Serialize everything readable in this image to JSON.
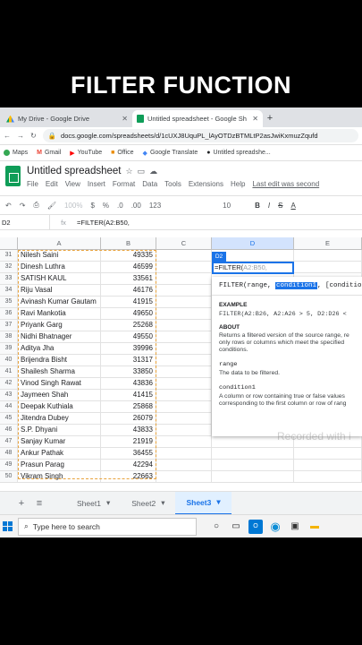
{
  "banner": {
    "title": "FILTER FUNCTION"
  },
  "browser": {
    "tabs": [
      {
        "label": "My Drive - Google Drive",
        "icon": "drive-icon",
        "active": false
      },
      {
        "label": "Untitled spreadsheet - Google Sh",
        "icon": "sheets-icon",
        "active": true
      }
    ],
    "url": "docs.google.com/spreadsheets/d/1cUXJ8UquPL_lAyOTDzBTMLtP2asJwiKxmuzZqufd",
    "bookmarks": [
      "Maps",
      "Gmail",
      "YouTube",
      "Office",
      "Google Translate",
      "Untitled spreadshe..."
    ]
  },
  "sheets": {
    "doc_title": "Untitled spreadsheet",
    "menus": [
      "File",
      "Edit",
      "View",
      "Insert",
      "Format",
      "Data",
      "Tools",
      "Extensions",
      "Help"
    ],
    "last_edit": "Last edit was second",
    "toolbar": {
      "zoom": "100%",
      "currency": "$",
      "percent": "%",
      "dec_less": ".0",
      "dec_more": ".00",
      "format": "123",
      "font_size": "10"
    },
    "cell_ref": "D2",
    "formula": "=FILTER(A2:B50,",
    "columns": [
      "A",
      "B",
      "C",
      "D",
      "E"
    ],
    "rows": [
      {
        "n": "31",
        "name": "Nilesh Saini",
        "val": "49335"
      },
      {
        "n": "32",
        "name": "Dinesh Luthra",
        "val": "46599"
      },
      {
        "n": "33",
        "name": "SATISH KAUL",
        "val": "33561"
      },
      {
        "n": "34",
        "name": "Riju Vasal",
        "val": "46176"
      },
      {
        "n": "35",
        "name": "Avinash Kumar Gautam",
        "val": "41915"
      },
      {
        "n": "36",
        "name": "Ravi Mankotia",
        "val": "49650"
      },
      {
        "n": "37",
        "name": "Priyank Garg",
        "val": "25268"
      },
      {
        "n": "38",
        "name": "Nidhi Bhatnager",
        "val": "49550"
      },
      {
        "n": "39",
        "name": "Aditya Jha",
        "val": "39996"
      },
      {
        "n": "40",
        "name": "Brijendra Bisht",
        "val": "31317"
      },
      {
        "n": "41",
        "name": "Shailesh Sharma",
        "val": "33850"
      },
      {
        "n": "42",
        "name": "Vinod Singh Rawat",
        "val": "43836"
      },
      {
        "n": "43",
        "name": "Jaymeen Shah",
        "val": "41415"
      },
      {
        "n": "44",
        "name": "Deepak Kuthiala",
        "val": "25868"
      },
      {
        "n": "45",
        "name": "Jitendra Dubey",
        "val": "26079"
      },
      {
        "n": "46",
        "name": "S.P. Dhyani",
        "val": "43833"
      },
      {
        "n": "47",
        "name": "Sanjay Kumar",
        "val": "21919"
      },
      {
        "n": "48",
        "name": "Ankur Pathak",
        "val": "36455"
      },
      {
        "n": "49",
        "name": "Prasun Parag",
        "val": "42294"
      },
      {
        "n": "50",
        "name": "Vikram Singh",
        "val": "22663"
      }
    ],
    "active_cell": {
      "ref": "D2",
      "typed": "=FILTER(",
      "hint": "A2:B50,",
      "tag": "D2"
    },
    "help": {
      "signature_pre": "FILTER(range, ",
      "signature_hl": "condition1",
      "signature_post": ", [condition",
      "example_label": "EXAMPLE",
      "example": "FILTER(A2:B26, A2:A26 > 5, D2:D26 <",
      "about_label": "ABOUT",
      "about": "Returns a filtered version of the source range, re only rows or columns which meet the specified conditions.",
      "arg1": "range",
      "arg1_desc": "The data to be filtered.",
      "arg2": "condition1",
      "arg2_desc": "A column or row containing true or false values corresponding to the first column or row of rang"
    },
    "watermark": "Recorded with i",
    "sheet_tabs": [
      "Sheet1",
      "Sheet2",
      "Sheet3"
    ],
    "active_sheet": "Sheet3"
  },
  "taskbar": {
    "search_placeholder": "Type here to search"
  }
}
